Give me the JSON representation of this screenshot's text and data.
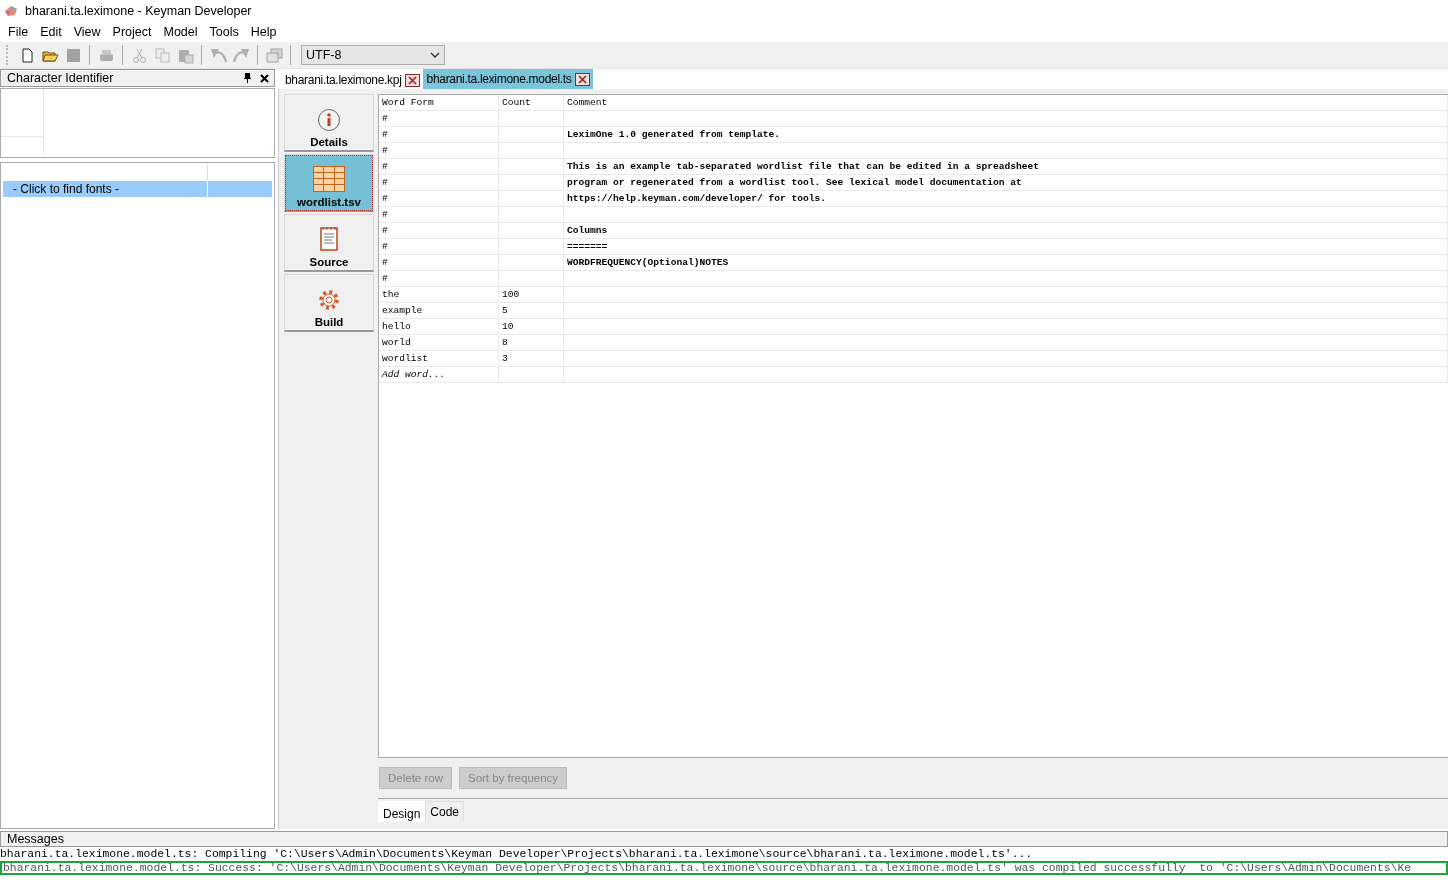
{
  "window": {
    "title": "bharani.ta.leximone - Keyman Developer"
  },
  "menu": [
    "File",
    "Edit",
    "View",
    "Project",
    "Model",
    "Tools",
    "Help"
  ],
  "toolbar": {
    "items": [
      {
        "kind": "new",
        "disabled": false
      },
      {
        "kind": "open",
        "disabled": false
      },
      {
        "kind": "save",
        "disabled": true
      },
      {
        "kind": "sep"
      },
      {
        "kind": "print",
        "disabled": true
      },
      {
        "kind": "sep"
      },
      {
        "kind": "cut",
        "disabled": true
      },
      {
        "kind": "copy",
        "disabled": true
      },
      {
        "kind": "paste",
        "disabled": true
      },
      {
        "kind": "sep"
      },
      {
        "kind": "undo",
        "disabled": true
      },
      {
        "kind": "redo",
        "disabled": true
      },
      {
        "kind": "sep"
      },
      {
        "kind": "windows",
        "disabled": true
      },
      {
        "kind": "sep"
      }
    ],
    "encoding": "UTF-8"
  },
  "character_identifier": {
    "title": "Character Identifier",
    "font_list": [
      {
        "label": "- Click to find fonts -",
        "selected": true
      }
    ]
  },
  "document_tabs": [
    {
      "label": "bharani.ta.leximone.kpj",
      "selected": false
    },
    {
      "label": "bharani.ta.leximone.model.ts",
      "selected": true
    }
  ],
  "side_nav": [
    {
      "label": "Details",
      "kind": "info",
      "selected": false
    },
    {
      "label": "wordlist.tsv",
      "kind": "table",
      "selected": true
    },
    {
      "label": "Source",
      "kind": "notepad",
      "selected": false
    },
    {
      "label": "Build",
      "kind": "gear",
      "selected": false
    }
  ],
  "wordlist": {
    "columns": [
      "Word Form",
      "Count",
      "Comment"
    ],
    "rows": [
      {
        "word_form": "#",
        "count": "",
        "comment": ""
      },
      {
        "word_form": "#",
        "count": "",
        "comment": "LeximOne 1.0 generated from template."
      },
      {
        "word_form": "#",
        "count": "",
        "comment": ""
      },
      {
        "word_form": "#",
        "count": "",
        "comment": "This is an example tab-separated wordlist file that can be edited in a spreadsheet"
      },
      {
        "word_form": "#",
        "count": "",
        "comment": "program or regenerated from a wordlist tool. See lexical model documentation at"
      },
      {
        "word_form": "#",
        "count": "",
        "comment": "https://help.keyman.com/developer/ for tools."
      },
      {
        "word_form": "#",
        "count": "",
        "comment": ""
      },
      {
        "word_form": "#",
        "count": "",
        "comment": "Columns"
      },
      {
        "word_form": "#",
        "count": "",
        "comment": "======="
      },
      {
        "word_form": "#",
        "count": "",
        "comment": "WORDFREQUENCY(Optional)NOTES"
      },
      {
        "word_form": "#",
        "count": "",
        "comment": ""
      },
      {
        "word_form": "the",
        "count": "100",
        "comment": ""
      },
      {
        "word_form": "example",
        "count": "5",
        "comment": ""
      },
      {
        "word_form": "hello",
        "count": "10",
        "comment": ""
      },
      {
        "word_form": "world",
        "count": "8",
        "comment": ""
      },
      {
        "word_form": "wordlist",
        "count": "3",
        "comment": ""
      }
    ],
    "add_row_placeholder": "Add word..."
  },
  "buttons": [
    {
      "label": "Delete row",
      "disabled": true
    },
    {
      "label": "Sort by frequency",
      "disabled": true
    }
  ],
  "view_tabs": [
    {
      "label": "Design",
      "selected": true
    },
    {
      "label": "Code",
      "selected": false
    }
  ],
  "messages": {
    "title": "Messages",
    "lines": [
      {
        "text": "bharani.ta.leximone.model.ts: Compiling 'C:\\Users\\Admin\\Documents\\Keyman Developer\\Projects\\bharani.ta.leximone\\source\\bharani.ta.leximone.model.ts'...",
        "kind": "info"
      },
      {
        "text": "bharani.ta.leximone.model.ts: Success: 'C:\\Users\\Admin\\Documents\\Keyman Developer\\Projects\\bharani.ta.leximone\\source\\bharani.ta.leximone.model.ts' was compiled successfully  to 'C:\\Users\\Admin\\Documents\\Ke",
        "kind": "success"
      }
    ]
  }
}
